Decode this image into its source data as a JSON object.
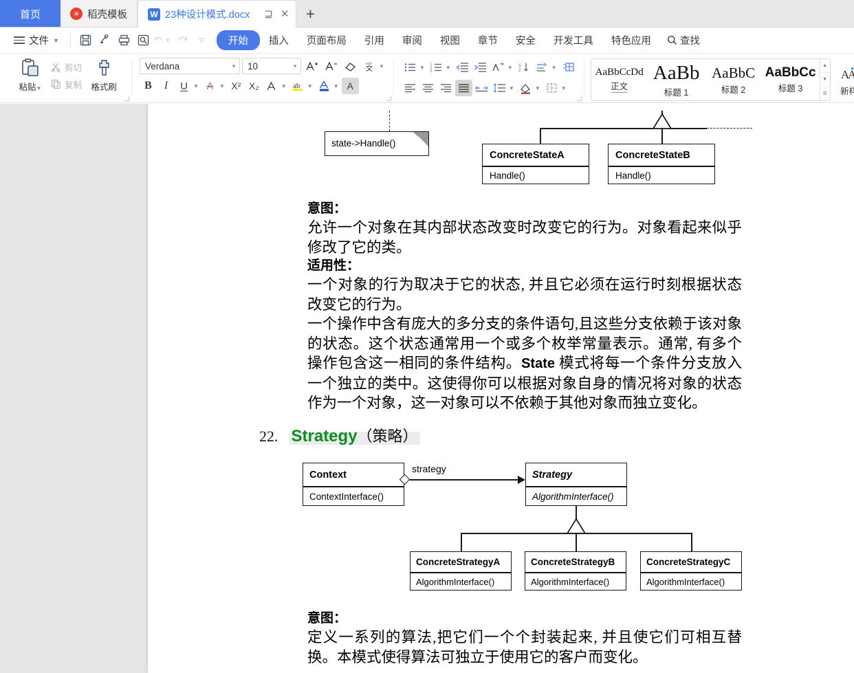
{
  "window": {
    "tabs": [
      {
        "label": "首页",
        "icon": "home-tab",
        "state": "home"
      },
      {
        "label": "稻壳模板",
        "icon": "docer-icon",
        "state": "inactive"
      },
      {
        "label": "23种设计模式.docx",
        "icon": "wps-writer-icon",
        "state": "active"
      }
    ],
    "tab_actions": {
      "cast": "⊒",
      "close": "✕"
    },
    "new_tab": "+"
  },
  "menubar": {
    "file_label": "文件",
    "quick_access": [
      "save-icon",
      "sync-icon",
      "print-icon",
      "print-preview-icon",
      "undo-icon",
      "redo-icon",
      "customize-icon"
    ],
    "tabs": [
      {
        "label": "开始",
        "selected": true
      },
      {
        "label": "插入",
        "selected": false
      },
      {
        "label": "页面布局",
        "selected": false
      },
      {
        "label": "引用",
        "selected": false
      },
      {
        "label": "审阅",
        "selected": false
      },
      {
        "label": "视图",
        "selected": false
      },
      {
        "label": "章节",
        "selected": false
      },
      {
        "label": "安全",
        "selected": false
      },
      {
        "label": "开发工具",
        "selected": false
      },
      {
        "label": "特色应用",
        "selected": false
      }
    ],
    "search_label": "查找",
    "accent_color": "#4a7ae8"
  },
  "ribbon": {
    "clipboard": {
      "paste_label": "粘贴",
      "cut_label": "剪切",
      "copy_label": "复制",
      "format_painter_label": "格式刷"
    },
    "font": {
      "family_value": "Verdana",
      "size_value": "10",
      "grow_label": "A+",
      "shrink_label": "A-",
      "clear_format": "clear-format-icon",
      "pinyin_label": "文",
      "bold_label": "B",
      "italic_label": "I",
      "underline_label": "U",
      "strikethrough_label": "A",
      "superscript_label": "X²",
      "subscript_label": "X₂",
      "char_border_label": "A",
      "highlight_label": "ab",
      "font_color_label": "A",
      "char_shading_label": "A"
    },
    "paragraph": {
      "bullets": "bullet-list-icon",
      "numbering": "numbered-list-icon",
      "decrease_indent": "decrease-indent-icon",
      "increase_indent": "increase-indent-icon",
      "pinyin_guide": "pinyin-guide-icon",
      "sort": "sort-icon",
      "show_marks": "show-marks-icon",
      "align_left": "align-left-icon",
      "align_center": "align-center-icon",
      "align_right": "align-right-icon",
      "align_justify": "align-justify-icon",
      "distribute": "distribute-icon",
      "line_spacing": "line-spacing-icon",
      "shading": "shading-icon",
      "borders": "borders-icon"
    },
    "styles": {
      "items": [
        {
          "preview": "AaBbCcDd",
          "name": "正文",
          "current": true
        },
        {
          "preview": "AaBb",
          "name": "标题 1",
          "current": false
        },
        {
          "preview": "AaBbC",
          "name": "标题 2",
          "current": false
        },
        {
          "preview": "AaBbCc",
          "name": "标题 3",
          "current": false
        }
      ],
      "new_style_label": "新样"
    }
  },
  "document": {
    "state_diagram": {
      "note_text": "state->Handle()",
      "classes": [
        {
          "name": "ConcreteStateA",
          "operation": "Handle()"
        },
        {
          "name": "ConcreteStateB",
          "operation": "Handle()"
        }
      ]
    },
    "state_section": {
      "intent_label": "意图：",
      "intent_body": "允许一个对象在其内部状态改变时改变它的行为。对象看起来似乎修改了它的类。",
      "applicability_label": "适用性：",
      "applicability_1": "一个对象的行为取决于它的状态, 并且它必须在运行时刻根据状态改变它的行为。",
      "applicability_2_a": "一个操作中含有庞大的多分支的条件语句,且这些分支依赖于该对象的状态。这个状态通常用一个或多个枚举常量表示。通常, 有多个操作包含这一相同的条件结构。",
      "applicability_2_kw": "State",
      "applicability_2_b": "模式将每一个条件分支放入一个独立的类中。这使得你可以根据对象自身的情况将对象的状态作为一个对象，这一对象可以不依赖于其他对象而独立变化。"
    },
    "strategy_heading": {
      "number": "22.",
      "english": "Strategy",
      "chinese": "（策略）",
      "color": "#0a8f1e",
      "highlight": "#ececec"
    },
    "strategy_diagram": {
      "context": {
        "name": "Context",
        "operation": "ContextInterface()"
      },
      "association_label": "strategy",
      "strategy": {
        "name": "Strategy",
        "operation": "AlgorithmInterface()"
      },
      "concretes": [
        {
          "name": "ConcreteStrategyA",
          "operation": "AlgorithmInterface()"
        },
        {
          "name": "ConcreteStrategyB",
          "operation": "AlgorithmInterface()"
        },
        {
          "name": "ConcreteStrategyC",
          "operation": "AlgorithmInterface()"
        }
      ]
    },
    "strategy_section": {
      "intent_label": "意图：",
      "intent_body": "定义一系列的算法,把它们一个个封装起来, 并且使它们可相互替换。本模式使得算法可独立于使用它的客户而变化。"
    }
  }
}
